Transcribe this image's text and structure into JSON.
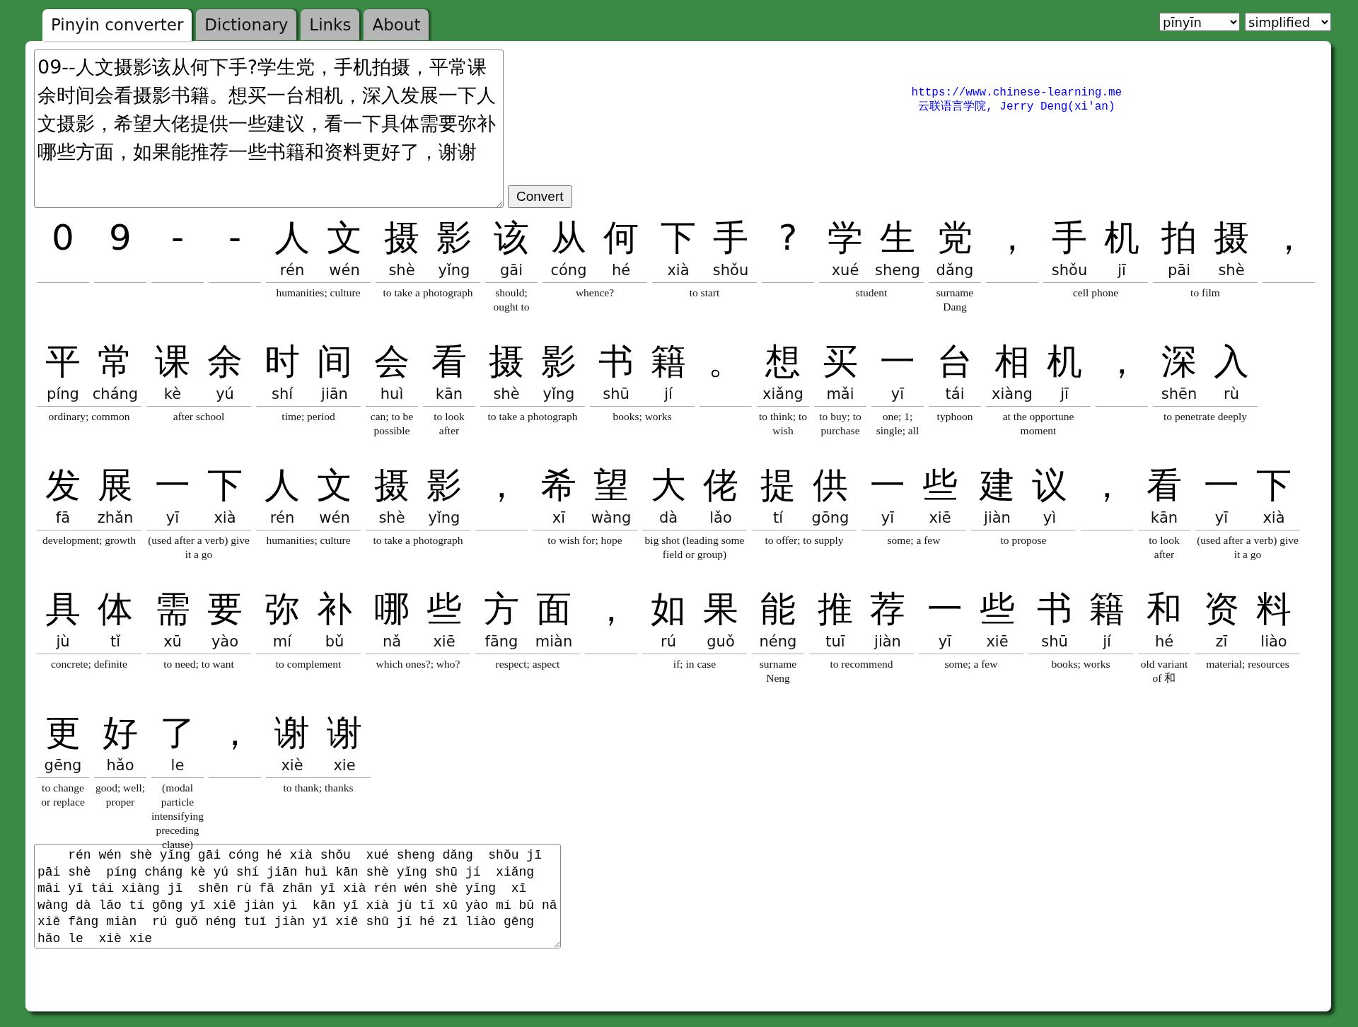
{
  "tabs": [
    {
      "label": "Pinyin converter",
      "selected": true
    },
    {
      "label": "Dictionary",
      "selected": false
    },
    {
      "label": "Links",
      "selected": false
    },
    {
      "label": "About",
      "selected": false
    }
  ],
  "selects": [
    {
      "value": "pīnyīn"
    },
    {
      "value": "simplified"
    }
  ],
  "input": {
    "value": "09--人文摄影该从何下手?学生党，手机拍摄，平常课余时间会看摄影书籍。想买一台相机，深入发展一下人文摄影，希望大佬提供一些建议，看一下具体需要弥补哪些方面，如果能推荐一些书籍和资料更好了，谢谢"
  },
  "convert_button": "Convert",
  "credit": {
    "url": "https://www.chinese-learning.me",
    "author": "云联语言学院, Jerry Deng(xi'an)"
  },
  "words": [
    {
      "chars": [
        {
          "hanzi": "0"
        }
      ]
    },
    {
      "chars": [
        {
          "hanzi": "9"
        }
      ]
    },
    {
      "chars": [
        {
          "hanzi": "-"
        }
      ]
    },
    {
      "chars": [
        {
          "hanzi": "-"
        }
      ]
    },
    {
      "chars": [
        {
          "hanzi": "人",
          "pinyin": "rén"
        },
        {
          "hanzi": "文",
          "pinyin": "wén"
        }
      ],
      "gloss": "humanities; culture"
    },
    {
      "chars": [
        {
          "hanzi": "摄",
          "pinyin": "shè"
        },
        {
          "hanzi": "影",
          "pinyin": "yǐng"
        }
      ],
      "gloss": "to take a photograph"
    },
    {
      "chars": [
        {
          "hanzi": "该",
          "pinyin": "gāi"
        }
      ],
      "gloss": "should; ought to"
    },
    {
      "chars": [
        {
          "hanzi": "从",
          "pinyin": "cóng"
        },
        {
          "hanzi": "何",
          "pinyin": "hé"
        }
      ],
      "gloss": "whence?"
    },
    {
      "chars": [
        {
          "hanzi": "下",
          "pinyin": "xià"
        },
        {
          "hanzi": "手",
          "pinyin": "shǒu"
        }
      ],
      "gloss": "to start"
    },
    {
      "chars": [
        {
          "hanzi": "?"
        }
      ]
    },
    {
      "chars": [
        {
          "hanzi": "学",
          "pinyin": "xué"
        },
        {
          "hanzi": "生",
          "pinyin": "sheng"
        }
      ],
      "gloss": "student"
    },
    {
      "chars": [
        {
          "hanzi": "党",
          "pinyin": "dǎng"
        }
      ],
      "gloss": "surname Dang"
    },
    {
      "chars": [
        {
          "hanzi": "，"
        }
      ]
    },
    {
      "chars": [
        {
          "hanzi": "手",
          "pinyin": "shǒu"
        },
        {
          "hanzi": "机",
          "pinyin": "jī"
        }
      ],
      "gloss": "cell phone"
    },
    {
      "chars": [
        {
          "hanzi": "拍",
          "pinyin": "pāi"
        },
        {
          "hanzi": "摄",
          "pinyin": "shè"
        }
      ],
      "gloss": "to film"
    },
    {
      "chars": [
        {
          "hanzi": "，"
        }
      ]
    },
    {
      "chars": [
        {
          "hanzi": "平",
          "pinyin": "píng"
        },
        {
          "hanzi": "常",
          "pinyin": "cháng"
        }
      ],
      "gloss": "ordinary; common"
    },
    {
      "chars": [
        {
          "hanzi": "课",
          "pinyin": "kè"
        },
        {
          "hanzi": "余",
          "pinyin": "yú"
        }
      ],
      "gloss": "after school"
    },
    {
      "chars": [
        {
          "hanzi": "时",
          "pinyin": "shí"
        },
        {
          "hanzi": "间",
          "pinyin": "jiān"
        }
      ],
      "gloss": "time; period"
    },
    {
      "chars": [
        {
          "hanzi": "会",
          "pinyin": "huì"
        }
      ],
      "gloss": "can; to be possible"
    },
    {
      "chars": [
        {
          "hanzi": "看",
          "pinyin": "kān"
        }
      ],
      "gloss": "to look after"
    },
    {
      "chars": [
        {
          "hanzi": "摄",
          "pinyin": "shè"
        },
        {
          "hanzi": "影",
          "pinyin": "yǐng"
        }
      ],
      "gloss": "to take a photograph"
    },
    {
      "chars": [
        {
          "hanzi": "书",
          "pinyin": "shū"
        },
        {
          "hanzi": "籍",
          "pinyin": "jí"
        }
      ],
      "gloss": "books; works"
    },
    {
      "chars": [
        {
          "hanzi": "。"
        }
      ]
    },
    {
      "chars": [
        {
          "hanzi": "想",
          "pinyin": "xiǎng"
        }
      ],
      "gloss": "to think; to wish"
    },
    {
      "chars": [
        {
          "hanzi": "买",
          "pinyin": "mǎi"
        }
      ],
      "gloss": "to buy; to purchase"
    },
    {
      "chars": [
        {
          "hanzi": "一",
          "pinyin": "yī"
        }
      ],
      "gloss": "one; 1; single; all"
    },
    {
      "chars": [
        {
          "hanzi": "台",
          "pinyin": "tái"
        }
      ],
      "gloss": "typhoon"
    },
    {
      "chars": [
        {
          "hanzi": "相",
          "pinyin": "xiàng"
        },
        {
          "hanzi": "机",
          "pinyin": "jī"
        }
      ],
      "gloss": "at the opportune moment"
    },
    {
      "chars": [
        {
          "hanzi": "，"
        }
      ]
    },
    {
      "chars": [
        {
          "hanzi": "深",
          "pinyin": "shēn"
        },
        {
          "hanzi": "入",
          "pinyin": "rù"
        }
      ],
      "gloss": "to penetrate deeply"
    },
    {
      "chars": [
        {
          "hanzi": "发",
          "pinyin": "fā"
        },
        {
          "hanzi": "展",
          "pinyin": "zhǎn"
        }
      ],
      "gloss": "development; growth"
    },
    {
      "chars": [
        {
          "hanzi": "一",
          "pinyin": "yī"
        },
        {
          "hanzi": "下",
          "pinyin": "xià"
        }
      ],
      "gloss": "(used after a verb) give it a go"
    },
    {
      "chars": [
        {
          "hanzi": "人",
          "pinyin": "rén"
        },
        {
          "hanzi": "文",
          "pinyin": "wén"
        }
      ],
      "gloss": "humanities; culture"
    },
    {
      "chars": [
        {
          "hanzi": "摄",
          "pinyin": "shè"
        },
        {
          "hanzi": "影",
          "pinyin": "yǐng"
        }
      ],
      "gloss": "to take a photograph"
    },
    {
      "chars": [
        {
          "hanzi": "，"
        }
      ]
    },
    {
      "chars": [
        {
          "hanzi": "希",
          "pinyin": "xī"
        },
        {
          "hanzi": "望",
          "pinyin": "wàng"
        }
      ],
      "gloss": "to wish for; hope"
    },
    {
      "chars": [
        {
          "hanzi": "大",
          "pinyin": "dà"
        },
        {
          "hanzi": "佬",
          "pinyin": "lǎo"
        }
      ],
      "gloss": "big shot (leading some field or group)"
    },
    {
      "chars": [
        {
          "hanzi": "提",
          "pinyin": "tí"
        },
        {
          "hanzi": "供",
          "pinyin": "gōng"
        }
      ],
      "gloss": "to offer; to supply"
    },
    {
      "chars": [
        {
          "hanzi": "一",
          "pinyin": "yī"
        },
        {
          "hanzi": "些",
          "pinyin": "xiē"
        }
      ],
      "gloss": "some; a few"
    },
    {
      "chars": [
        {
          "hanzi": "建",
          "pinyin": "jiàn"
        },
        {
          "hanzi": "议",
          "pinyin": "yì"
        }
      ],
      "gloss": "to propose"
    },
    {
      "chars": [
        {
          "hanzi": "，"
        }
      ]
    },
    {
      "chars": [
        {
          "hanzi": "看",
          "pinyin": "kān"
        }
      ],
      "gloss": "to look after"
    },
    {
      "chars": [
        {
          "hanzi": "一",
          "pinyin": "yī"
        },
        {
          "hanzi": "下",
          "pinyin": "xià"
        }
      ],
      "gloss": "(used after a verb) give it a go"
    },
    {
      "chars": [
        {
          "hanzi": "具",
          "pinyin": "jù"
        },
        {
          "hanzi": "体",
          "pinyin": "tǐ"
        }
      ],
      "gloss": "concrete; definite"
    },
    {
      "chars": [
        {
          "hanzi": "需",
          "pinyin": "xū"
        },
        {
          "hanzi": "要",
          "pinyin": "yào"
        }
      ],
      "gloss": "to need; to want"
    },
    {
      "chars": [
        {
          "hanzi": "弥",
          "pinyin": "mí"
        },
        {
          "hanzi": "补",
          "pinyin": "bǔ"
        }
      ],
      "gloss": "to complement"
    },
    {
      "chars": [
        {
          "hanzi": "哪",
          "pinyin": "nǎ"
        },
        {
          "hanzi": "些",
          "pinyin": "xiē"
        }
      ],
      "gloss": "which ones?; who?"
    },
    {
      "chars": [
        {
          "hanzi": "方",
          "pinyin": "fāng"
        },
        {
          "hanzi": "面",
          "pinyin": "miàn"
        }
      ],
      "gloss": "respect; aspect"
    },
    {
      "chars": [
        {
          "hanzi": "，"
        }
      ]
    },
    {
      "chars": [
        {
          "hanzi": "如",
          "pinyin": "rú"
        },
        {
          "hanzi": "果",
          "pinyin": "guǒ"
        }
      ],
      "gloss": "if; in case"
    },
    {
      "chars": [
        {
          "hanzi": "能",
          "pinyin": "néng"
        }
      ],
      "gloss": "surname Neng"
    },
    {
      "chars": [
        {
          "hanzi": "推",
          "pinyin": "tuī"
        },
        {
          "hanzi": "荐",
          "pinyin": "jiàn"
        }
      ],
      "gloss": "to recommend"
    },
    {
      "chars": [
        {
          "hanzi": "一",
          "pinyin": "yī"
        },
        {
          "hanzi": "些",
          "pinyin": "xiē"
        }
      ],
      "gloss": "some; a few"
    },
    {
      "chars": [
        {
          "hanzi": "书",
          "pinyin": "shū"
        },
        {
          "hanzi": "籍",
          "pinyin": "jí"
        }
      ],
      "gloss": "books; works"
    },
    {
      "chars": [
        {
          "hanzi": "和",
          "pinyin": "hé"
        }
      ],
      "gloss": "old variant of 和"
    },
    {
      "chars": [
        {
          "hanzi": "资",
          "pinyin": "zī"
        },
        {
          "hanzi": "料",
          "pinyin": "liào"
        }
      ],
      "gloss": "material; resources"
    },
    {
      "chars": [
        {
          "hanzi": "更",
          "pinyin": "gēng"
        }
      ],
      "gloss": "to change or replace"
    },
    {
      "chars": [
        {
          "hanzi": "好",
          "pinyin": "hǎo"
        }
      ],
      "gloss": "good; well; proper"
    },
    {
      "chars": [
        {
          "hanzi": "了",
          "pinyin": "le"
        }
      ],
      "gloss": "(modal particle intensifying preceding clause)"
    },
    {
      "chars": [
        {
          "hanzi": "，"
        }
      ]
    },
    {
      "chars": [
        {
          "hanzi": "谢",
          "pinyin": "xiè"
        },
        {
          "hanzi": "谢",
          "pinyin": "xie"
        }
      ],
      "gloss": "to thank; thanks"
    }
  ],
  "output": {
    "value": "    rén wén shè yǐng gāi cóng hé xià shǒu  xué sheng dǎng  shǒu jī pāi shè  píng cháng kè yú shí jiān huì kān shè yǐng shū jí  xiǎng mǎi yī tái xiàng jī  shēn rù fā zhǎn yī xià rén wén shè yǐng  xī wàng dà lǎo tí gōng yī xiē jiàn yì  kān yī xià jù tǐ xū yào mí bǔ nǎ xiē fāng miàn  rú guǒ néng tuī jiàn yī xiē shū jí hé zī liào gēng hǎo le  xiè xie"
  }
}
